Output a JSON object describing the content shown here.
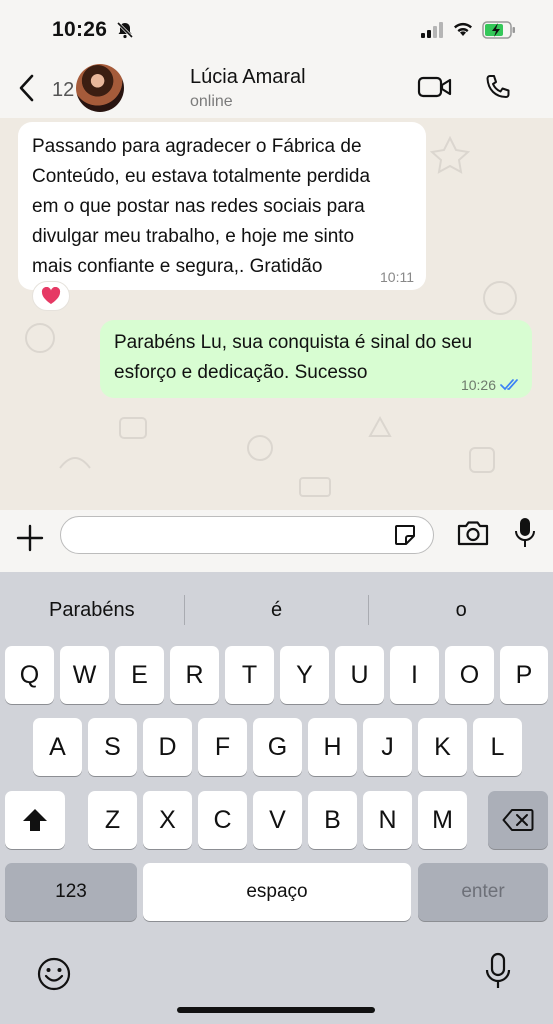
{
  "status_bar": {
    "time": "10:26",
    "icons": [
      "bell-slash-icon",
      "signal-icon",
      "wifi-icon",
      "battery-charging-icon"
    ]
  },
  "header": {
    "unread_count": "12",
    "contact_name": "Lúcia Amaral",
    "contact_status": "online",
    "icons": [
      "back-chevron-icon",
      "video-call-icon",
      "phone-icon"
    ]
  },
  "messages": [
    {
      "direction": "incoming",
      "lines": [
        "Passando para agradecer o Fábrica de",
        "Conteúdo, eu estava totalmente perdida",
        "em o que postar nas redes sociais para",
        "divulgar meu trabalho, e hoje me sinto",
        "mais confiante e segura,. Gratidão"
      ],
      "time": "10:11",
      "reaction": "heart"
    },
    {
      "direction": "outgoing",
      "lines": [
        "Parabéns Lu, sua conquista é sinal do seu",
        "esforço e dedicação. Sucesso"
      ],
      "time": "10:26",
      "read_status": "read"
    }
  ],
  "input": {
    "value": "",
    "placeholder": ""
  },
  "colors": {
    "incoming_bubble": "#ffffff",
    "outgoing_bubble": "#d8fdd2",
    "chat_bg": "#efeae2",
    "read_ticks": "#3b82f6"
  },
  "keyboard": {
    "suggestions": [
      "Parabéns",
      "é",
      "o"
    ],
    "row1": [
      "Q",
      "W",
      "E",
      "R",
      "T",
      "Y",
      "U",
      "I",
      "O",
      "P"
    ],
    "row2": [
      "A",
      "S",
      "D",
      "F",
      "G",
      "H",
      "J",
      "K",
      "L"
    ],
    "row3": [
      "Z",
      "X",
      "C",
      "V",
      "B",
      "N",
      "M"
    ],
    "numbers_label": "123",
    "space_label": "espaço",
    "enter_label": "enter"
  }
}
